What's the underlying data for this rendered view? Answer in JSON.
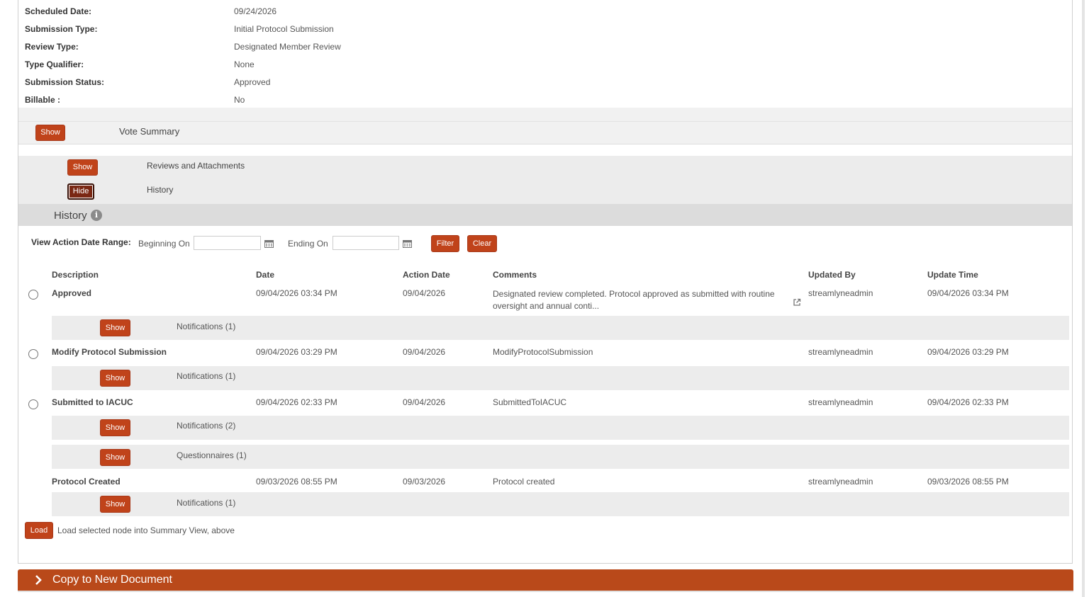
{
  "summary": {
    "rows": [
      {
        "label": "Scheduled Date:",
        "value": "09/24/2026"
      },
      {
        "label": "Submission Type:",
        "value": "Initial Protocol Submission"
      },
      {
        "label": "Review Type:",
        "value": "Designated Member Review"
      },
      {
        "label": "Type Qualifier:",
        "value": "None"
      },
      {
        "label": "Submission Status:",
        "value": "Approved"
      },
      {
        "label": "Billable :",
        "value": "No"
      }
    ]
  },
  "vote_summary": {
    "button": "Show",
    "label": "Vote Summary"
  },
  "reviews": {
    "button": "Show",
    "label": "Reviews and Attachments"
  },
  "history_toggle": {
    "button": "Hide",
    "label": "History"
  },
  "history": {
    "title": "History",
    "filter": {
      "range_label": "View Action Date Range:",
      "beginning_label": "Beginning On",
      "beginning_value": "",
      "ending_label": "Ending On",
      "ending_value": "",
      "filter_button": "Filter",
      "clear_button": "Clear"
    },
    "columns": [
      "Description",
      "Date",
      "Action Date",
      "Comments",
      "Updated By",
      "Update Time"
    ],
    "rows": [
      {
        "description": "Approved",
        "date": "09/04/2026 03:34 PM",
        "action_date": "09/04/2026",
        "comments": "Designated review completed. Protocol approved as submitted with routine oversight and annual conti...",
        "updated_by": "streamlyneadmin",
        "update_time": "09/04/2026 03:34 PM"
      },
      {
        "description": "Modify Protocol Submission",
        "date": "09/04/2026 03:29 PM",
        "action_date": "09/04/2026",
        "comments": "ModifyProtocolSubmission",
        "updated_by": "streamlyneadmin",
        "update_time": "09/04/2026 03:29 PM"
      },
      {
        "description": "Submitted to IACUC",
        "date": "09/04/2026 02:33 PM",
        "action_date": "09/04/2026",
        "comments": "SubmittedToIACUC",
        "updated_by": "streamlyneadmin",
        "update_time": "09/04/2026 02:33 PM"
      },
      {
        "description": "Protocol Created",
        "date": "09/03/2026 08:55 PM",
        "action_date": "09/03/2026",
        "comments": "Protocol created",
        "updated_by": "streamlyneadmin",
        "update_time": "09/03/2026 08:55 PM"
      }
    ],
    "subsections": [
      {
        "button": "Show",
        "label": "Notifications (1)"
      },
      {
        "button": "Show",
        "label": "Notifications (1)"
      },
      {
        "button": "Show",
        "label": "Notifications (2)"
      },
      {
        "button": "Show",
        "label": "Questionnaires (1)"
      },
      {
        "button": "Show",
        "label": "Notifications (1)"
      }
    ],
    "load_button": "Load",
    "load_text": "Load selected node into Summary View, above"
  },
  "copy_bar": {
    "label": "Copy to New Document"
  },
  "colors": {
    "accent": "#c0431a",
    "copy_bar": "#b9491a",
    "band": "#ececec"
  }
}
